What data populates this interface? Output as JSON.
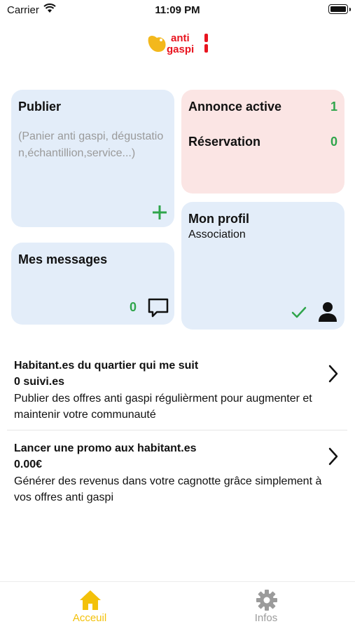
{
  "status_bar": {
    "carrier": "Carrier",
    "time": "11:09 PM"
  },
  "logo": {
    "line1": "anti",
    "line2": "gaspi"
  },
  "colors": {
    "accent_green": "#2fa54b",
    "accent_yellow": "#f3c10a",
    "card_blue": "#e3edf9",
    "card_pink": "#fbe5e4"
  },
  "publish": {
    "title": "Publier",
    "hint": "(Panier anti gaspi, dégustation,échantillion,service...)",
    "icon": "plus-icon"
  },
  "messages": {
    "title": "Mes messages",
    "count": "0",
    "icon": "chat-bubble-icon"
  },
  "stats": {
    "active_label": "Annonce active",
    "active_value": "1",
    "reservation_label": "Réservation",
    "reservation_value": "0"
  },
  "profile": {
    "title": "Mon profil",
    "type": "Association",
    "icons": [
      "check-icon",
      "person-icon"
    ]
  },
  "list": [
    {
      "title": "Habitant.es du quartier qui me suit",
      "value": "0 suivi.es",
      "description": "Publier des offres anti gaspi régulièrment pour augmenter et maintenir votre communauté"
    },
    {
      "title": "Lancer une promo aux habitant.es",
      "value": "0.00€",
      "description": "Générer des revenus dans votre cagnotte grâce simplement à vos offres anti gaspi"
    }
  ],
  "tabs": [
    {
      "label": "Acceuil",
      "icon": "home-icon",
      "active": true
    },
    {
      "label": "Infos",
      "icon": "gear-icon",
      "active": false
    }
  ]
}
